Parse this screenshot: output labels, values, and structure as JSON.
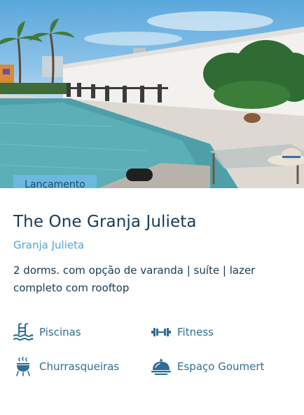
{
  "card": {
    "badge": "Lançamento",
    "title": "The One Granja Julieta",
    "neighborhood": "Granja Julieta",
    "description": "2 dorms. com opção de varanda | suíte | lazer completo com rooftop",
    "amenities": [
      {
        "label": "Piscinas",
        "icon": "pool-icon"
      },
      {
        "label": "Fitness",
        "icon": "dumbbell-icon"
      },
      {
        "label": "Churrasqueiras",
        "icon": "grill-icon"
      },
      {
        "label": "Espaço Goumert",
        "icon": "cloche-icon"
      }
    ]
  },
  "colors": {
    "badge_bg": "#6cb8e3",
    "title": "#163a55",
    "accent": "#4fa6d8",
    "icon": "#2f6d96"
  }
}
